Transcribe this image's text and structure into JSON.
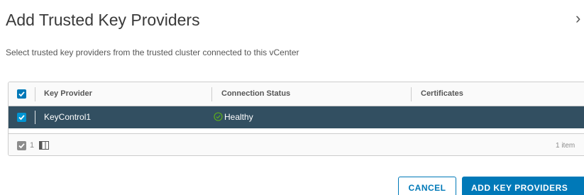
{
  "dialog": {
    "title": "Add Trusted Key Providers",
    "close_glyph": "›",
    "subtitle": "Select trusted key providers from the trusted cluster connected to this vCenter"
  },
  "grid": {
    "columns": [
      "Key Provider",
      "Connection Status",
      "Certificates"
    ],
    "rows": [
      {
        "selected": true,
        "key_provider": "KeyControl1",
        "connection_status": "Healthy",
        "status_icon": "check-circle-icon",
        "certificates": ""
      }
    ],
    "footer": {
      "selected_count": "1",
      "item_count_label": "1 item",
      "column_toggle_icon": "columns-icon"
    }
  },
  "buttons": {
    "cancel": "CANCEL",
    "add": "ADD KEY PROVIDERS"
  },
  "colors": {
    "accent": "#0079b8",
    "selected_row": "#324f61",
    "healthy": "#60b515"
  }
}
